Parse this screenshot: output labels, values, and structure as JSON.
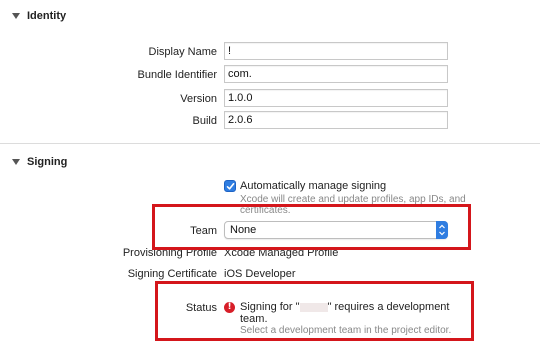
{
  "identity": {
    "section_title": "Identity",
    "display_name_label": "Display Name",
    "display_name_value": "!",
    "bundle_id_label": "Bundle Identifier",
    "bundle_id_value": "com.",
    "version_label": "Version",
    "version_value": "1.0.0",
    "build_label": "Build",
    "build_value": "2.0.6"
  },
  "signing": {
    "section_title": "Signing",
    "auto_manage_label": "Automatically manage signing",
    "auto_manage_checked": true,
    "auto_manage_help_line1": "Xcode will create and update profiles, app IDs, and",
    "auto_manage_help_line2": "certificates.",
    "team_label": "Team",
    "team_value": "None",
    "provisioning_profile_label": "Provisioning Profile",
    "provisioning_profile_value": "Xcode Managed Profile",
    "signing_certificate_label": "Signing Certificate",
    "signing_certificate_value": "iOS Developer",
    "status_label": "Status",
    "status_icon": "error-icon",
    "status_message_prefix": "Signing for \"",
    "status_message_suffix": "\" requires a development",
    "status_message_line2": "team.",
    "status_help": "Select a development team in the project editor."
  },
  "colors": {
    "highlight_box": "#d4161b",
    "accent": "#2f7de1",
    "error": "#d71e28"
  }
}
